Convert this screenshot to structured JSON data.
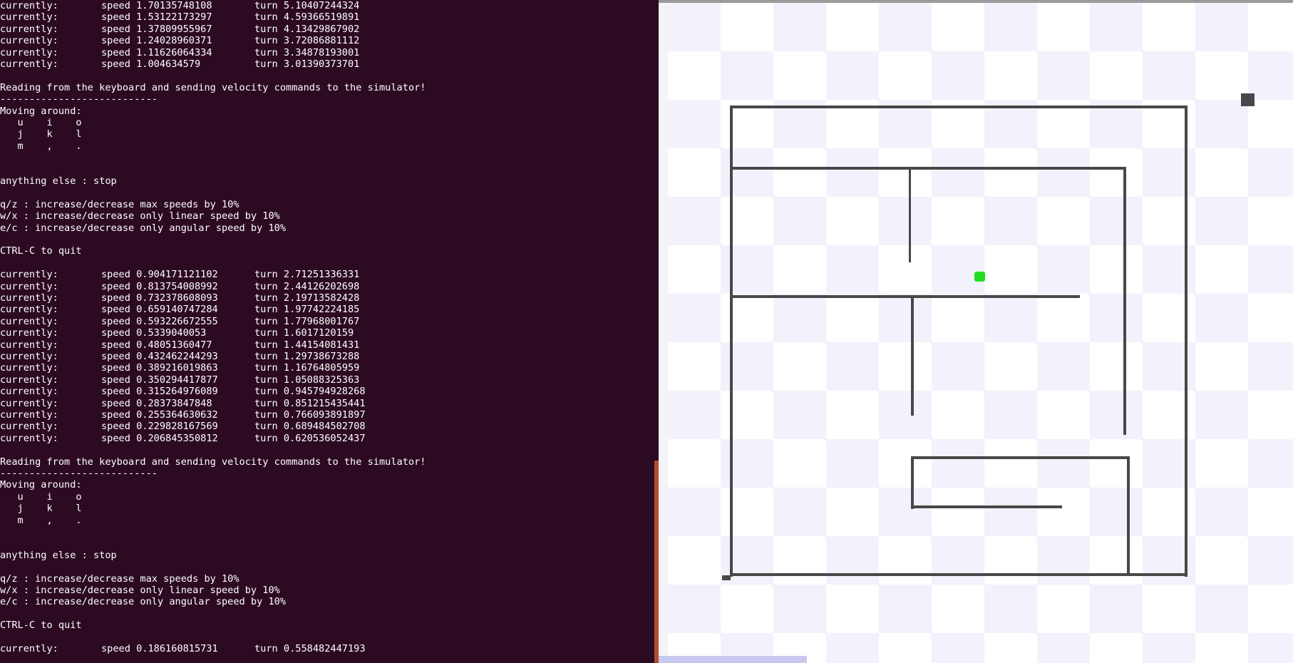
{
  "terminal": {
    "background": "#2c0b22",
    "text_color": "#ffffff",
    "lines": [
      {
        "label": "currently:",
        "speed": "speed 1.70135748108",
        "turn": "turn 5.10407244324"
      },
      {
        "label": "currently:",
        "speed": "speed 1.53122173297",
        "turn": "turn 4.59366519891"
      },
      {
        "label": "currently:",
        "speed": "speed 1.37809955967",
        "turn": "turn 4.13429867902"
      },
      {
        "label": "currently:",
        "speed": "speed 1.24028960371",
        "turn": "turn 3.72086881112"
      },
      {
        "label": "currently:",
        "speed": "speed 1.11626064334",
        "turn": "turn 3.34878193001"
      },
      {
        "label": "currently:",
        "speed": "speed 1.004634579",
        "turn": "turn 3.01390373701"
      },
      {
        "text": ""
      },
      {
        "text": "Reading from the keyboard and sending velocity commands to the simulator!"
      },
      {
        "text": "---------------------------"
      },
      {
        "text": "Moving around:"
      },
      {
        "text": "   u    i    o"
      },
      {
        "text": "   j    k    l"
      },
      {
        "text": "   m    ,    ."
      },
      {
        "text": ""
      },
      {
        "text": ""
      },
      {
        "text": "anything else : stop"
      },
      {
        "text": ""
      },
      {
        "text": "q/z : increase/decrease max speeds by 10%"
      },
      {
        "text": "w/x : increase/decrease only linear speed by 10%"
      },
      {
        "text": "e/c : increase/decrease only angular speed by 10%"
      },
      {
        "text": ""
      },
      {
        "text": "CTRL-C to quit"
      },
      {
        "text": ""
      },
      {
        "label": "currently:",
        "speed": "speed 0.904171121102",
        "turn": "turn 2.71251336331"
      },
      {
        "label": "currently:",
        "speed": "speed 0.813754008992",
        "turn": "turn 2.44126202698"
      },
      {
        "label": "currently:",
        "speed": "speed 0.732378608093",
        "turn": "turn 2.19713582428"
      },
      {
        "label": "currently:",
        "speed": "speed 0.659140747284",
        "turn": "turn 1.97742224185"
      },
      {
        "label": "currently:",
        "speed": "speed 0.593226672555",
        "turn": "turn 1.77968001767"
      },
      {
        "label": "currently:",
        "speed": "speed 0.5339040053",
        "turn": "turn 1.6017120159"
      },
      {
        "label": "currently:",
        "speed": "speed 0.48051360477",
        "turn": "turn 1.44154081431"
      },
      {
        "label": "currently:",
        "speed": "speed 0.432462244293",
        "turn": "turn 1.29738673288"
      },
      {
        "label": "currently:",
        "speed": "speed 0.389216019863",
        "turn": "turn 1.16764805959"
      },
      {
        "label": "currently:",
        "speed": "speed 0.350294417877",
        "turn": "turn 1.05088325363"
      },
      {
        "label": "currently:",
        "speed": "speed 0.315264976089",
        "turn": "turn 0.945794928268"
      },
      {
        "label": "currently:",
        "speed": "speed 0.28373847848",
        "turn": "turn 0.851215435441"
      },
      {
        "label": "currently:",
        "speed": "speed 0.255364630632",
        "turn": "turn 0.766093891897"
      },
      {
        "label": "currently:",
        "speed": "speed 0.229828167569",
        "turn": "turn 0.689484502708"
      },
      {
        "label": "currently:",
        "speed": "speed 0.206845350812",
        "turn": "turn 0.620536052437"
      },
      {
        "text": ""
      },
      {
        "text": "Reading from the keyboard and sending velocity commands to the simulator!"
      },
      {
        "text": "---------------------------"
      },
      {
        "text": "Moving around:"
      },
      {
        "text": "   u    i    o"
      },
      {
        "text": "   j    k    l"
      },
      {
        "text": "   m    ,    ."
      },
      {
        "text": ""
      },
      {
        "text": ""
      },
      {
        "text": "anything else : stop"
      },
      {
        "text": ""
      },
      {
        "text": "q/z : increase/decrease max speeds by 10%"
      },
      {
        "text": "w/x : increase/decrease only linear speed by 10%"
      },
      {
        "text": "e/c : increase/decrease only angular speed by 10%"
      },
      {
        "text": ""
      },
      {
        "text": "CTRL-C to quit"
      },
      {
        "text": ""
      },
      {
        "label": "currently:",
        "speed": "speed 0.186160815731",
        "turn": "turn 0.558482447193"
      }
    ]
  },
  "simulator": {
    "checker_light": "#ffffff",
    "checker_dark": "#f2f2fc",
    "wall_color": "#484848",
    "robot_color": "#22dd22",
    "robot_icon": "robot-icon"
  }
}
